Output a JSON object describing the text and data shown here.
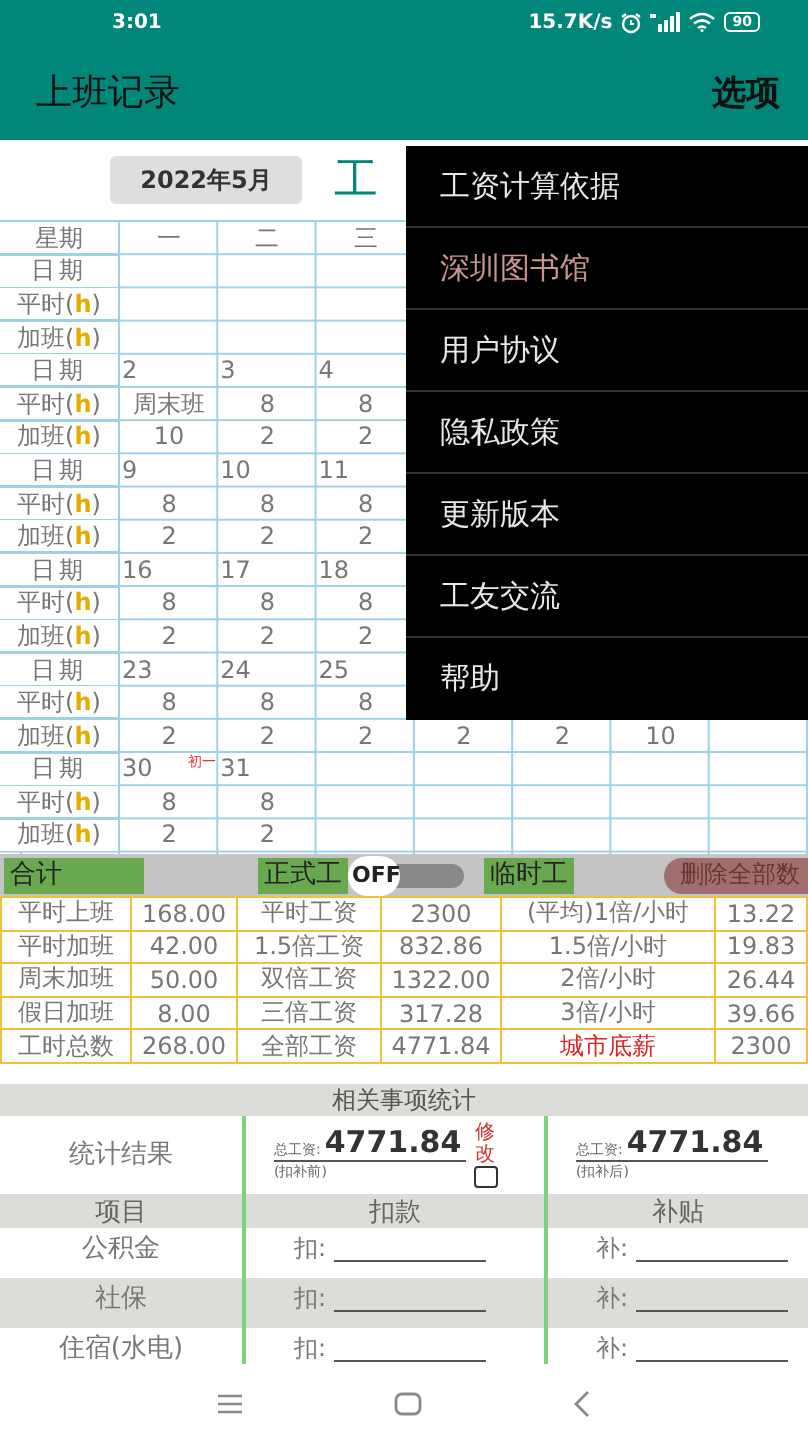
{
  "status_bar": {
    "time": "3:01",
    "speed": "15.7K/s",
    "battery": "90"
  },
  "app_bar": {
    "title": "上班记录",
    "menu_button": "选项"
  },
  "month_button": "2022年5月",
  "heading": "工",
  "calendar": {
    "weekday_label": "星期",
    "weekdays": [
      "一",
      "二",
      "三"
    ],
    "rows": [
      {
        "kind": "date",
        "label": "日期",
        "cells": [
          null,
          null,
          null,
          null,
          null,
          null,
          null
        ]
      },
      {
        "kind": "hours",
        "label": "平时(**h**)",
        "cells": [
          null,
          null,
          null,
          null,
          null,
          null,
          null
        ]
      },
      {
        "kind": "hours",
        "label": "加班(**h**)",
        "cells": [
          null,
          null,
          null,
          null,
          null,
          null,
          null
        ]
      },
      {
        "kind": "date",
        "label": "日期",
        "cells": [
          "2",
          "3",
          "4",
          null,
          null,
          null,
          null
        ]
      },
      {
        "kind": "hours",
        "label": "平时(**h**)",
        "cells": [
          "周末班",
          "8",
          "8",
          null,
          null,
          null,
          null
        ]
      },
      {
        "kind": "hours",
        "label": "加班(**h**)",
        "cells": [
          "10",
          "2",
          "2",
          null,
          null,
          null,
          null
        ]
      },
      {
        "kind": "date",
        "label": "日期",
        "cells": [
          "9",
          "10",
          "11",
          null,
          null,
          null,
          null
        ]
      },
      {
        "kind": "hours",
        "label": "平时(**h**)",
        "cells": [
          "8",
          "8",
          "8",
          null,
          null,
          null,
          null
        ]
      },
      {
        "kind": "hours",
        "label": "加班(**h**)",
        "cells": [
          "2",
          "2",
          "2",
          null,
          null,
          null,
          null
        ]
      },
      {
        "kind": "date",
        "label": "日期",
        "cells": [
          "16",
          "17",
          "18",
          null,
          null,
          null,
          null
        ]
      },
      {
        "kind": "hours",
        "label": "平时(**h**)",
        "cells": [
          "8",
          "8",
          "8",
          null,
          null,
          null,
          null
        ]
      },
      {
        "kind": "hours",
        "label": "加班(**h**)",
        "cells": [
          "2",
          "2",
          "2",
          null,
          null,
          null,
          null
        ]
      },
      {
        "kind": "date",
        "label": "日期",
        "cells": [
          "23",
          "24",
          "25",
          null,
          null,
          null,
          null
        ]
      },
      {
        "kind": "hours",
        "label": "平时(**h**)",
        "cells": [
          "8",
          "8",
          "8",
          null,
          null,
          null,
          null
        ]
      },
      {
        "kind": "hours",
        "label": "加班(**h**)",
        "cells": [
          "2",
          "2",
          "2",
          "2",
          "2",
          "10",
          null
        ]
      },
      {
        "kind": "date",
        "label": "日期",
        "cells": [
          {
            "text": "30",
            "lunar": "初一"
          },
          "31",
          null,
          null,
          null,
          null,
          null
        ]
      },
      {
        "kind": "hours",
        "label": "平时(**h**)",
        "cells": [
          "8",
          "8",
          null,
          null,
          null,
          null,
          null
        ]
      },
      {
        "kind": "hours",
        "label": "加班(**h**)",
        "cells": [
          "2",
          "2",
          null,
          null,
          null,
          null,
          null
        ]
      }
    ]
  },
  "summary_bar": {
    "total_label": "合计",
    "regular_label": "正式工",
    "toggle": {
      "on": false,
      "label": "OFF"
    },
    "temp_label": "临时工",
    "delete_button": "删除全部数"
  },
  "stats": [
    {
      "cells": [
        "平时上班",
        "168.00",
        "平时工资",
        "2300",
        "(平均)1倍/小时",
        "13.22"
      ],
      "alert": false
    },
    {
      "cells": [
        "平时加班",
        "42.00",
        "1.5倍工资",
        "832.86",
        "1.5倍/小时",
        "19.83"
      ],
      "alert": false
    },
    {
      "cells": [
        "周末加班",
        "50.00",
        "双倍工资",
        "1322.00",
        "2倍/小时",
        "26.44"
      ],
      "alert": false
    },
    {
      "cells": [
        "假日加班",
        "8.00",
        "三倍工资",
        "317.28",
        "3倍/小时",
        "39.66"
      ],
      "alert": false
    },
    {
      "cells": [
        "工时总数",
        "268.00",
        "全部工资",
        "4771.84",
        "城市底薪",
        "2300"
      ],
      "alert": true
    }
  ],
  "related": {
    "title": "相关事项统计",
    "result_label": "统计结果",
    "before": {
      "label": "总工资:",
      "value": "4771.84",
      "note": "(扣补前)",
      "edit_label": "修改",
      "edit_checked": false
    },
    "after": {
      "label": "总工资:",
      "value": "4771.84",
      "note": "(扣补后)"
    },
    "columns": [
      "项目",
      "扣款",
      "补贴"
    ],
    "items": [
      {
        "name": "公积金",
        "deduct_label": "扣:",
        "subsidy_label": "补:"
      },
      {
        "name": "社保",
        "deduct_label": "扣:",
        "subsidy_label": "补:"
      },
      {
        "name": "住宿(水电)",
        "deduct_label": "扣:",
        "subsidy_label": "补:"
      }
    ]
  },
  "menu": [
    {
      "label": "工资计算依据",
      "accent": false
    },
    {
      "label": "深圳图书馆",
      "accent": true
    },
    {
      "label": "用户协议",
      "accent": false
    },
    {
      "label": "隐私政策",
      "accent": false
    },
    {
      "label": "更新版本",
      "accent": false
    },
    {
      "label": "工友交流",
      "accent": false
    },
    {
      "label": "帮助",
      "accent": false
    }
  ]
}
